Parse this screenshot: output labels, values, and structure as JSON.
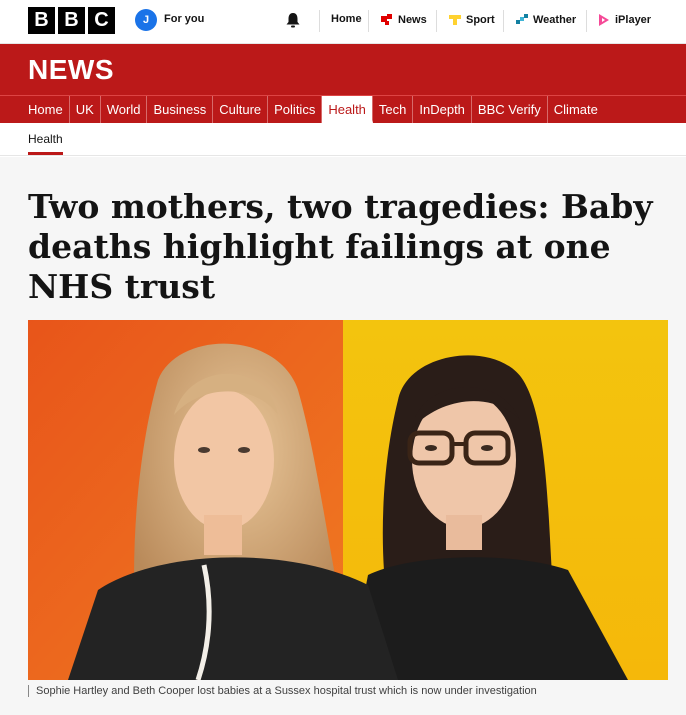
{
  "header": {
    "logo_letters": [
      "B",
      "B",
      "C"
    ],
    "avatar_initial": "J",
    "for_you_label": "For you",
    "links": [
      {
        "label": "Home",
        "icon": "home"
      },
      {
        "label": "News",
        "icon": "news-icon",
        "color": "#e00000"
      },
      {
        "label": "Sport",
        "icon": "sport-icon",
        "color": "#ffd230"
      },
      {
        "label": "Weather",
        "icon": "weather-icon",
        "color": "#1380a1"
      },
      {
        "label": "iPlayer",
        "icon": "iplayer-icon",
        "color": "#f54997"
      }
    ]
  },
  "banner": {
    "title": "NEWS",
    "color": "#bb1919"
  },
  "sections": [
    "Home",
    "UK",
    "World",
    "Business",
    "Culture",
    "Politics",
    "Health",
    "Tech",
    "InDepth",
    "BBC Verify",
    "Climate"
  ],
  "active_section": "Health",
  "breadcrumb": "Health",
  "article": {
    "headline": "Two mothers, two tragedies: Baby deaths highlight failings at one NHS trust",
    "caption": "Sophie Hartley and Beth Cooper lost babies at a Sussex hospital trust which is now under investigation"
  }
}
